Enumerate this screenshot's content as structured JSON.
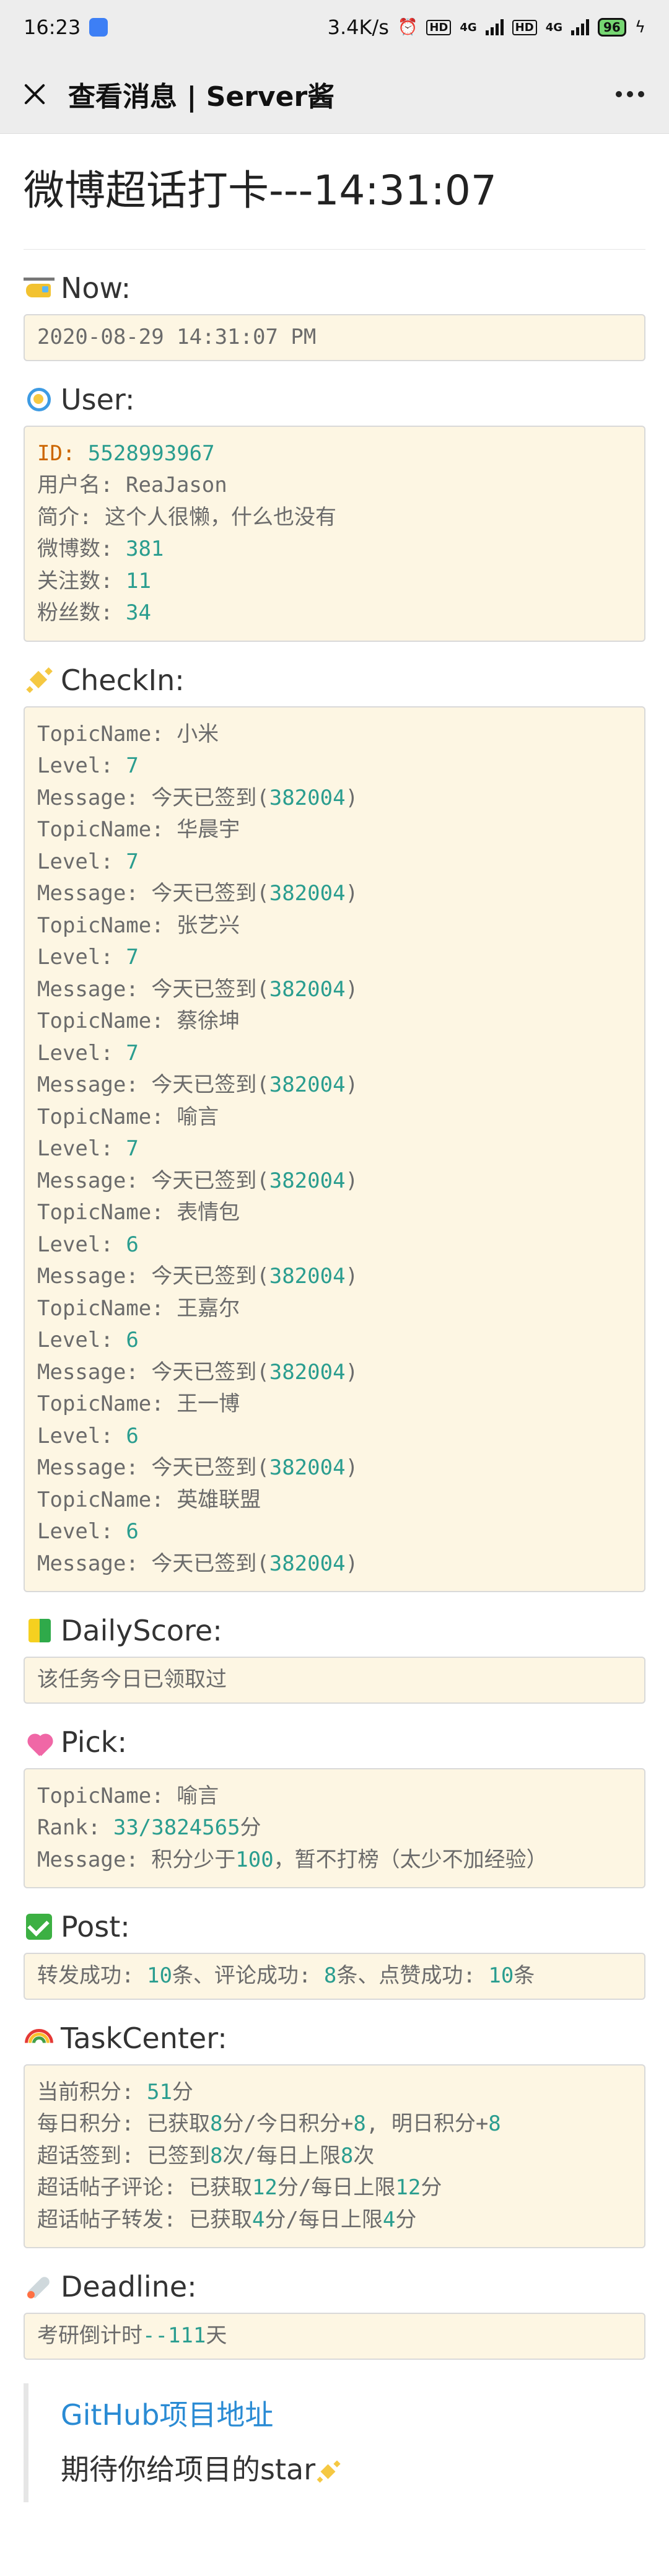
{
  "status_bar": {
    "time": "16:23",
    "net_speed": "3.4K/s",
    "hd1": "HD",
    "sig1": "4G",
    "hd2": "HD",
    "sig2": "4G",
    "battery": "96"
  },
  "window": {
    "title": "查看消息 | Server酱"
  },
  "page": {
    "title": "微博超话打卡---14:31:07"
  },
  "sections": {
    "now": {
      "title": "Now:",
      "value": "2020-08-29 14:31:07 PM"
    },
    "user": {
      "title": "User:",
      "id_label": "ID:",
      "id_value": "5528993967",
      "name_label": "用户名:",
      "name_value": "ReaJason",
      "bio_label": "简介:",
      "bio_value": "这个人很懒，什么也没有",
      "weibo_label": "微博数:",
      "weibo_value": "381",
      "follow_label": "关注数:",
      "follow_value": "11",
      "fans_label": "粉丝数:",
      "fans_value": "34"
    },
    "checkin": {
      "title": "CheckIn:",
      "topic_label": "TopicName:",
      "level_label": "Level:",
      "message_label": "Message:",
      "message_prefix": "今天已签到(",
      "message_code": "382004",
      "message_suffix": ")",
      "items": [
        {
          "topic": "小米",
          "level": "7"
        },
        {
          "topic": "华晨宇",
          "level": "7"
        },
        {
          "topic": "张艺兴",
          "level": "7"
        },
        {
          "topic": "蔡徐坤",
          "level": "7"
        },
        {
          "topic": "喻言",
          "level": "7"
        },
        {
          "topic": "表情包",
          "level": "6"
        },
        {
          "topic": "王嘉尔",
          "level": "6"
        },
        {
          "topic": "王一博",
          "level": "6"
        },
        {
          "topic": "英雄联盟",
          "level": "6"
        }
      ]
    },
    "daily_score": {
      "title": "DailyScore:",
      "value": "该任务今日已领取过"
    },
    "pick": {
      "title": "Pick:",
      "topic_label": "TopicName:",
      "topic_value": "喻言",
      "rank_label": "Rank:",
      "rank_value": "33/3824565",
      "rank_unit": "分",
      "message_label": "Message:",
      "message_a": "积分少于",
      "message_num": "100",
      "message_b": "，暂不打榜（太少不加经验）"
    },
    "post": {
      "title": "Post:",
      "forward_label": "转发成功:",
      "forward_value": "10",
      "comment_label": "条、评论成功:",
      "comment_value": "8",
      "like_label": "条、点赞成功:",
      "like_value": "10",
      "tail": "条"
    },
    "task_center": {
      "title": "TaskCenter:",
      "current_label": "当前积分:",
      "current_value": "51",
      "current_unit": "分",
      "daily_label": "每日积分: 已获取",
      "daily_got": "8",
      "daily_mid": "分/今日积分+",
      "daily_today": "8",
      "daily_mid2": ", 明日积分+",
      "daily_tomorrow": "8",
      "signin_label": "超话签到: 已签到",
      "signin_count": "8",
      "signin_mid": "次/每日上限",
      "signin_limit": "8",
      "signin_unit": "次",
      "comment_label": "超话帖子评论: 已获取",
      "comment_got": "12",
      "comment_mid": "分/每日上限",
      "comment_limit": "12",
      "comment_unit": "分",
      "forward_label": "超话帖子转发: 已获取",
      "forward_got": "4",
      "forward_mid": "分/每日上限",
      "forward_limit": "4",
      "forward_unit": "分"
    },
    "deadline": {
      "title": "Deadline:",
      "value_prefix": "考研倒计时",
      "value_num": "--111",
      "value_suffix": "天"
    }
  },
  "footer": {
    "github_link": "GitHub项目地址",
    "star_text": "期待你给项目的star"
  }
}
